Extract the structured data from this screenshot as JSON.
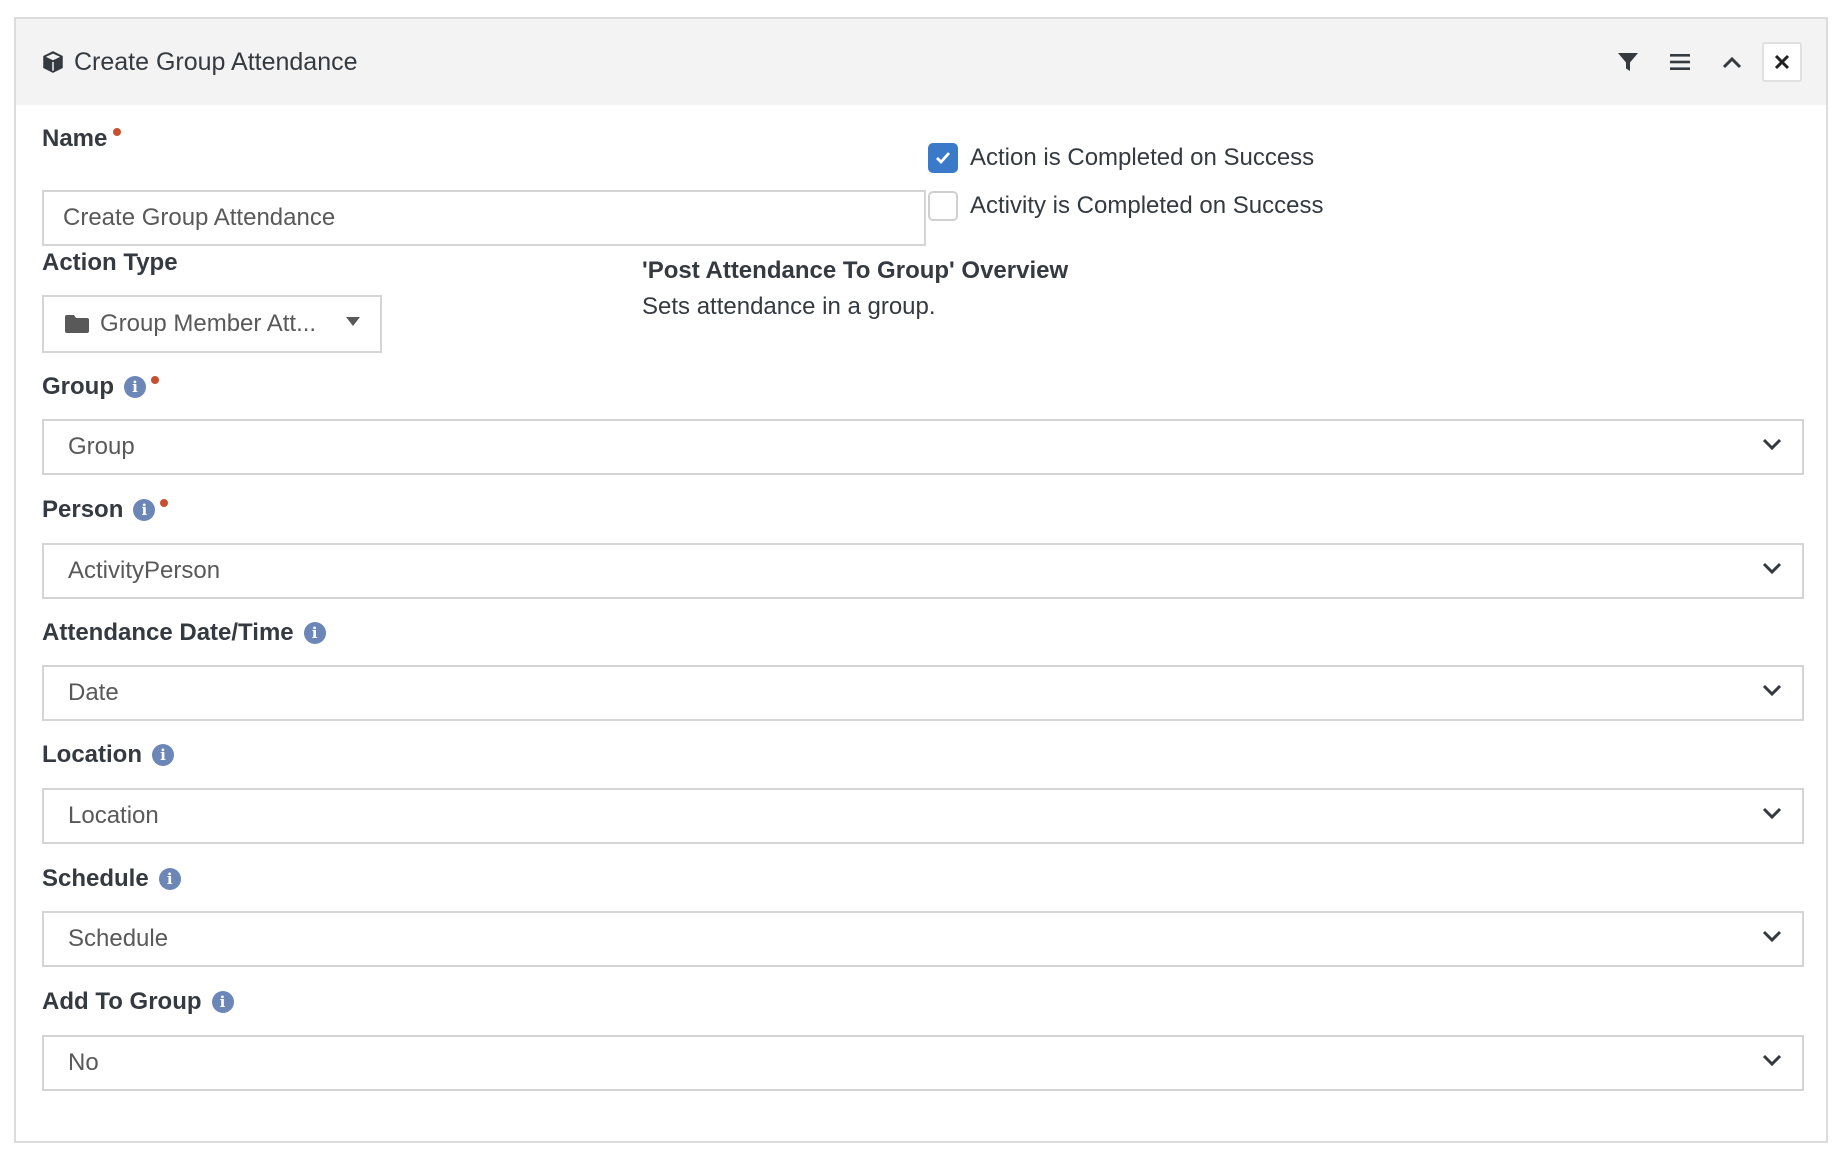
{
  "panel": {
    "title": "Create Group Attendance",
    "title_icon": "cube-icon",
    "actions": [
      "filter-icon",
      "menu-icon",
      "chevron-up-icon",
      "close-icon"
    ]
  },
  "form": {
    "name": {
      "label": "Name",
      "value": "Create Group Attendance",
      "required": true
    },
    "checkboxes": [
      {
        "label": "Action is Completed on Success",
        "checked": true
      },
      {
        "label": "Activity is Completed on Success",
        "checked": false
      }
    ],
    "action_type": {
      "label": "Action Type",
      "value": "Group Member Att...",
      "icon": "folder-icon"
    },
    "overview": {
      "title": "'Post Attendance To Group' Overview",
      "description": "Sets attendance in a group."
    },
    "fields": [
      {
        "label": "Group",
        "value": "Group",
        "info": true,
        "required": true
      },
      {
        "label": "Person",
        "value": "ActivityPerson",
        "info": true,
        "required": true
      },
      {
        "label": "Attendance Date/Time",
        "value": "Date",
        "info": true,
        "required": false
      },
      {
        "label": "Location",
        "value": "Location",
        "info": true,
        "required": false
      },
      {
        "label": "Schedule",
        "value": "Schedule",
        "info": true,
        "required": false
      },
      {
        "label": "Add To Group",
        "value": "No",
        "info": true,
        "required": false
      }
    ]
  },
  "colors": {
    "accent": "#3a7ac9",
    "required_dot": "#c9502f",
    "info_icon": "#6d86b8",
    "header_bg": "#f3f3f3"
  }
}
